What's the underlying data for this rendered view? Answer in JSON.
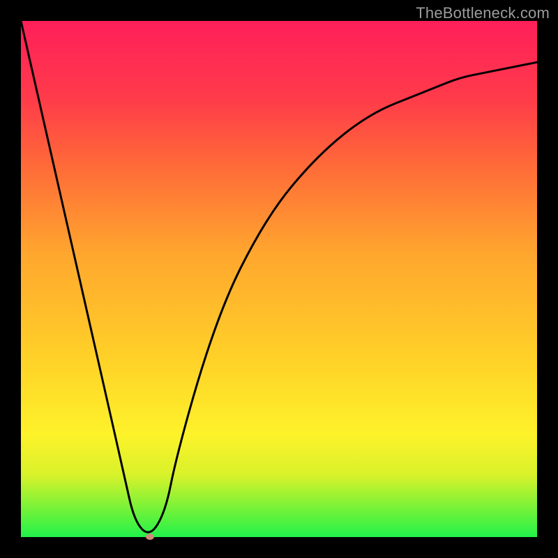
{
  "attribution": "TheBottleneck.com",
  "chart_data": {
    "type": "line",
    "title": "",
    "xlabel": "",
    "ylabel": "",
    "xlim": [
      0,
      100
    ],
    "ylim": [
      0,
      100
    ],
    "grid": false,
    "legend": false,
    "x": [
      0,
      5,
      10,
      15,
      20,
      22,
      25,
      28,
      30,
      35,
      40,
      45,
      50,
      55,
      60,
      65,
      70,
      75,
      80,
      85,
      90,
      95,
      100
    ],
    "values": [
      100,
      78,
      56,
      34,
      12,
      3,
      0,
      5,
      15,
      33,
      47,
      57,
      65,
      71,
      76,
      80,
      83,
      85,
      87,
      89,
      90,
      91,
      92
    ],
    "series_name": "bottleneck-curve",
    "marker": {
      "x": 25,
      "y": 0
    }
  },
  "colors": {
    "curve": "#000000",
    "marker": "#cf8a7a",
    "background_top": "#ff1f5a",
    "background_mid": "#ffd028",
    "background_bottom": "#21f24a",
    "frame": "#000000"
  }
}
